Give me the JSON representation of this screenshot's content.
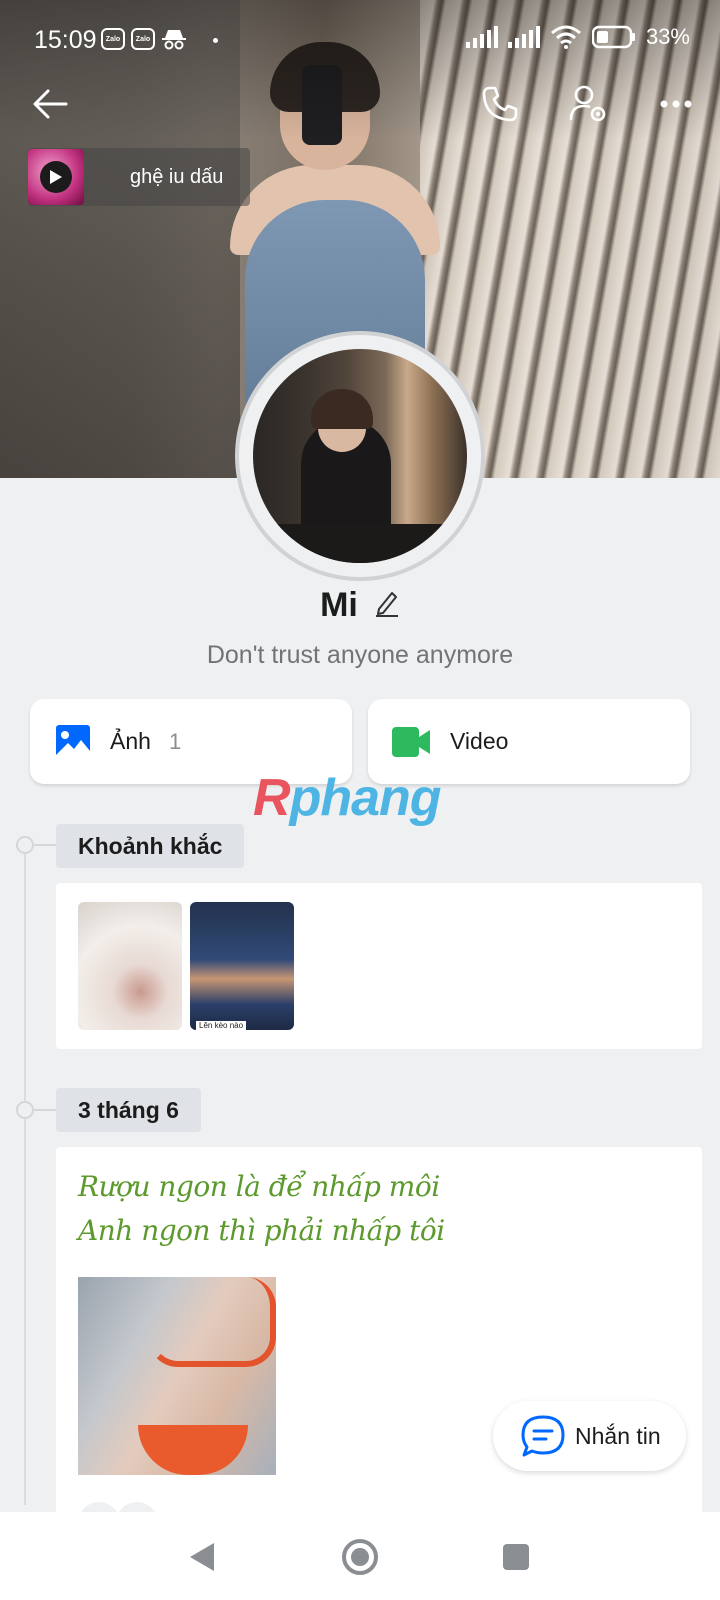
{
  "status_bar": {
    "time": "15:09",
    "notification_icons": [
      "Zalo",
      "Zalo"
    ],
    "battery_percent": "33%"
  },
  "profile": {
    "name": "Mi",
    "bio": "Don't trust anyone anymore",
    "music": {
      "title": "ghệ iu dấu"
    }
  },
  "media": {
    "photos_label": "Ảnh",
    "photos_count": "1",
    "videos_label": "Video"
  },
  "watermark": {
    "part1": "R",
    "part2": "phang"
  },
  "timeline": {
    "moments_label": "Khoảnh khắc",
    "moments": [
      {
        "caption": ""
      },
      {
        "caption": "Lên kèo nào"
      }
    ],
    "post": {
      "date_label": "3 tháng 6",
      "lines": [
        "Rượu ngon là để nhấp môi",
        "Anh ngon thì phải nhấp tôi"
      ]
    }
  },
  "message_button": {
    "label": "Nhắn tin"
  },
  "colors": {
    "accent_blue": "#0068ff",
    "video_green": "#2dba5f",
    "post_text_green": "#5d9a2e"
  }
}
